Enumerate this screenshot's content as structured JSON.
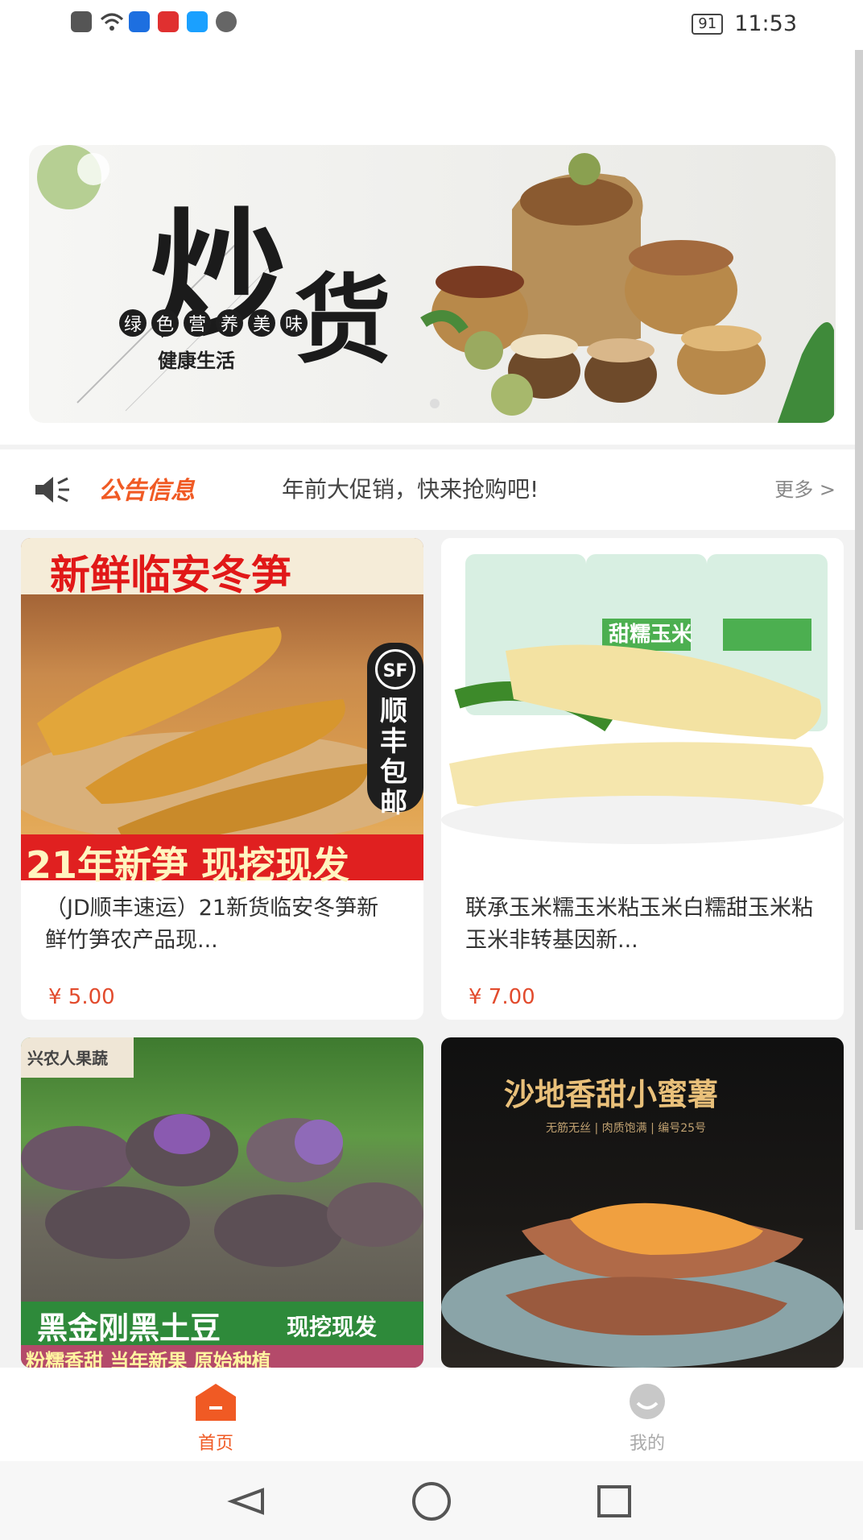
{
  "status_bar": {
    "battery": "91",
    "time": "11:53"
  },
  "banner": {
    "title_line1": "炒",
    "title_line2": "货",
    "tags": [
      "绿",
      "色",
      "营",
      "养",
      "美",
      "味"
    ],
    "subtitle": "健康生活"
  },
  "notice": {
    "title": "公告信息",
    "text": "年前大促销，快来抢购吧!",
    "more": "更多 >"
  },
  "products": [
    {
      "image_text_top": "新鲜临安冬笋",
      "image_text_bottom": "21年新笋 现挖现发",
      "badge": "顺丰包邮",
      "badge_logo": "SF",
      "title": "（JD顺丰速运）21新货临安冬笋新鲜竹笋农产品现...",
      "price": "¥ 5.00"
    },
    {
      "image_text_top": "甜糯玉米",
      "title": "联承玉米糯玉米粘玉米白糯甜玉米粘玉米非转基因新...",
      "price": "¥ 7.00"
    },
    {
      "image_text_corner": "兴农人果蔬",
      "image_text_bottom": "黑金刚黑土豆",
      "image_text_bottom_right": "现挖现发",
      "image_text_strip": "粉糯香甜 当年新果 原始种植"
    },
    {
      "image_text_top": "沙地香甜小蜜薯",
      "image_text_sub": "无筋无丝 | 肉质饱满 | 编号25号"
    }
  ],
  "tabs": [
    {
      "label": "首页",
      "active": true
    },
    {
      "label": "我的",
      "active": false
    }
  ],
  "colors": {
    "accent": "#f05a24",
    "price": "#e24b2d"
  }
}
